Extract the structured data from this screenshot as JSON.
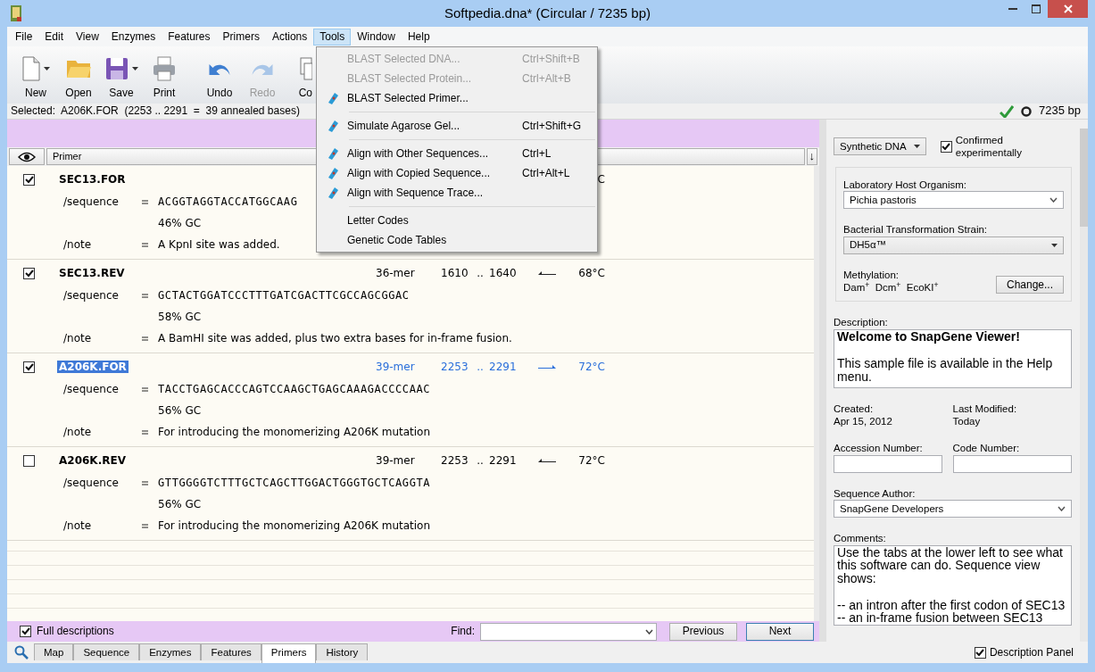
{
  "window": {
    "title": "Softpedia.dna*  (Circular / 7235 bp)"
  },
  "menu_bar": [
    {
      "label": "File",
      "selected": false
    },
    {
      "label": "Edit",
      "selected": false
    },
    {
      "label": "View",
      "selected": false
    },
    {
      "label": "Enzymes",
      "selected": false
    },
    {
      "label": "Features",
      "selected": false
    },
    {
      "label": "Primers",
      "selected": false
    },
    {
      "label": "Actions",
      "selected": false
    },
    {
      "label": "Tools",
      "selected": true
    },
    {
      "label": "Window",
      "selected": false
    },
    {
      "label": "Help",
      "selected": false
    }
  ],
  "toolbar": [
    {
      "kind": "new",
      "label": "New",
      "disabled": false,
      "dropdown": true
    },
    {
      "kind": "open",
      "label": "Open",
      "disabled": false,
      "dropdown": false
    },
    {
      "kind": "save",
      "label": "Save",
      "disabled": false,
      "dropdown": true
    },
    {
      "kind": "print",
      "label": "Print",
      "disabled": false,
      "dropdown": false
    },
    {
      "kind": "undo",
      "label": "Undo",
      "disabled": false,
      "dropdown": false
    },
    {
      "kind": "redo",
      "label": "Redo",
      "disabled": true,
      "dropdown": false
    },
    {
      "kind": "copy",
      "label": "Co",
      "disabled": false,
      "dropdown": false
    }
  ],
  "tools_menu": [
    {
      "kind": "item",
      "label": "BLAST Selected DNA...",
      "shortcut": "Ctrl+Shift+B",
      "disabled": true,
      "icon": false
    },
    {
      "kind": "item",
      "label": "BLAST Selected Protein...",
      "shortcut": "Ctrl+Alt+B",
      "disabled": true,
      "icon": false
    },
    {
      "kind": "item",
      "label": "BLAST Selected Primer...",
      "disabled": false,
      "icon": true
    },
    {
      "kind": "separator"
    },
    {
      "kind": "item",
      "label": "Simulate Agarose Gel...",
      "shortcut": "Ctrl+Shift+G",
      "disabled": false,
      "icon": true
    },
    {
      "kind": "separator"
    },
    {
      "kind": "item",
      "label": "Align with Other Sequences...",
      "shortcut": "Ctrl+L",
      "disabled": false,
      "icon": true
    },
    {
      "kind": "item",
      "label": "Align with Copied Sequence...",
      "shortcut": "Ctrl+Alt+L",
      "disabled": false,
      "icon": true
    },
    {
      "kind": "item",
      "label": "Align with Sequence Trace...",
      "disabled": false,
      "icon": true
    },
    {
      "kind": "separator"
    },
    {
      "kind": "item",
      "label": "Letter Codes",
      "disabled": false,
      "icon": false
    },
    {
      "kind": "item",
      "label": "Genetic Code Tables",
      "disabled": false,
      "icon": false
    }
  ],
  "status_bar": {
    "selection": "Selected:  A206K.FOR  (2253 .. 2291  =  39 annealed bases)",
    "length": "7235 bp"
  },
  "table": {
    "columns": [
      "Primer"
    ],
    "sort_button": "↓",
    "rows": [
      {
        "name": "SEC13.FOR",
        "checked": true,
        "selected": false,
        "temp": "C",
        "sequence_label": "/sequence",
        "sequence": "ACGGTAGGTACCATGGCAAG",
        "gc": "46% GC",
        "note_label": "/note",
        "note": "A KpnI site was added."
      },
      {
        "name": "SEC13.REV",
        "checked": true,
        "selected": false,
        "length": "36-mer",
        "start": "1610",
        "range_sep": "..",
        "end": "1640",
        "reverse": true,
        "temp": "68°C",
        "sequence_label": "/sequence",
        "sequence": "GCTACTGGATCCCTTTGATCGACTTCGCCAGCGGAC",
        "gc": "58% GC",
        "note_label": "/note",
        "note": "A BamHI site was added, plus two extra bases for in-frame fusion."
      },
      {
        "name": "A206K.FOR",
        "checked": true,
        "selected": true,
        "length": "39-mer",
        "start": "2253",
        "range_sep": "..",
        "end": "2291",
        "reverse": false,
        "temp": "72°C",
        "sequence_label": "/sequence",
        "sequence": "TACCTGAGCACCCAGTCCAAGCTGAGCAAAGACCCCAAC",
        "gc": "56% GC",
        "note_label": "/note",
        "note": "For introducing the monomerizing A206K mutation"
      },
      {
        "name": "A206K.REV",
        "checked": false,
        "selected": false,
        "length": "39-mer",
        "start": "2253",
        "range_sep": "..",
        "end": "2291",
        "reverse": true,
        "temp": "72°C",
        "sequence_label": "/sequence",
        "sequence": "GTTGGGGTCTTTGCTCAGCTTGGACTGGGTGCTCAGGTA",
        "gc": "56% GC",
        "note_label": "/note",
        "note": "For introducing the monomerizing A206K mutation"
      }
    ]
  },
  "find_bar": {
    "full_descriptions": {
      "label": "Full descriptions",
      "checked": true
    },
    "find_label": "Find:",
    "previous": "Previous",
    "next": "Next"
  },
  "view_tabs": [
    {
      "label": "Map",
      "selected": false
    },
    {
      "label": "Sequence",
      "selected": false
    },
    {
      "label": "Enzymes",
      "selected": false
    },
    {
      "label": "Features",
      "selected": false
    },
    {
      "label": "Primers",
      "selected": true
    },
    {
      "label": "History",
      "selected": false
    }
  ],
  "description_panel": {
    "molecule_type": "Synthetic DNA",
    "confirmed": {
      "label": "Confirmed experimentally",
      "checked": true
    },
    "host_label": "Laboratory Host Organism:",
    "host": "Pichia pastoris",
    "strain_label": "Bacterial Transformation Strain:",
    "strain": "DH5α™",
    "methylation_label": "Methylation:",
    "methylation": "Dam$^{+}$  Dcm$^{+}$  EcoKI$^{+}$",
    "change_button": "Change...",
    "description_label": "Description:",
    "description_title": "Welcome to SnapGene Viewer!",
    "description_text": "This sample file is available in the Help menu.",
    "created_label": "Created:",
    "created": "Apr 15, 2012",
    "modified_label": "Last Modified:",
    "modified": "Today",
    "accession_label": "Accession Number:",
    "code_label": "Code Number:",
    "author_label": "Sequence Author:",
    "author": "SnapGene Developers",
    "comments_label": "Comments:",
    "comments": [
      "Use the tabs at the lower left to see what this software can do. Sequence view shows:",
      "-- an intron after the first codon of SEC13",
      "-- an in-frame fusion between SEC13"
    ],
    "panel_toggle": {
      "label": "Description Panel",
      "checked": true
    }
  }
}
